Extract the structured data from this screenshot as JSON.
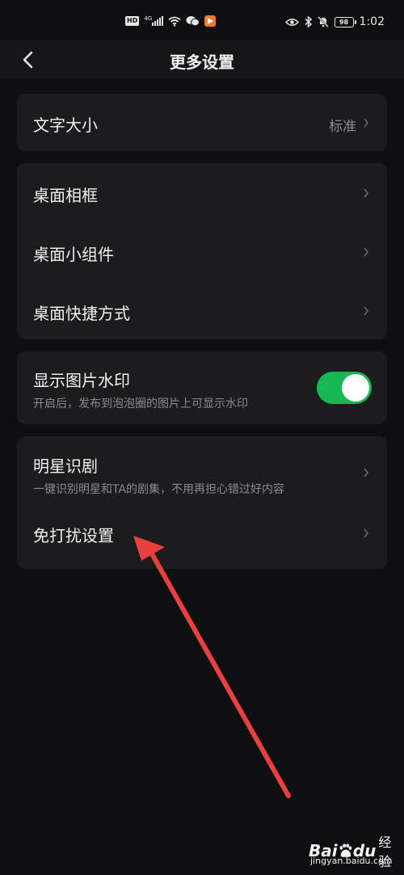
{
  "status_bar": {
    "hd": "HD",
    "network": "4G",
    "battery": "98",
    "time": "1:02"
  },
  "header": {
    "title": "更多设置"
  },
  "settings": {
    "font_size": {
      "label": "文字大小",
      "value": "标准"
    },
    "desktop_frame": {
      "label": "桌面相框"
    },
    "desktop_widget": {
      "label": "桌面小组件"
    },
    "desktop_shortcut": {
      "label": "桌面快捷方式"
    },
    "watermark": {
      "label": "显示图片水印",
      "description": "开启后，发布到泡泡圈的图片上可显示水印",
      "enabled": true
    },
    "star_recognition": {
      "label": "明星识剧",
      "description": "一键识别明星和TA的剧集，不用再担心错过好内容"
    },
    "do_not_disturb": {
      "label": "免打扰设置"
    }
  },
  "watermark_logo": {
    "brand_left": "Bai",
    "brand_right": "du",
    "suffix": "经验",
    "url": "jingyan.baidu.com"
  },
  "colors": {
    "background": "#0f0f11",
    "card": "#1c1c1e",
    "toggle_on": "#17b851",
    "annotation_arrow": "#e8403f"
  }
}
